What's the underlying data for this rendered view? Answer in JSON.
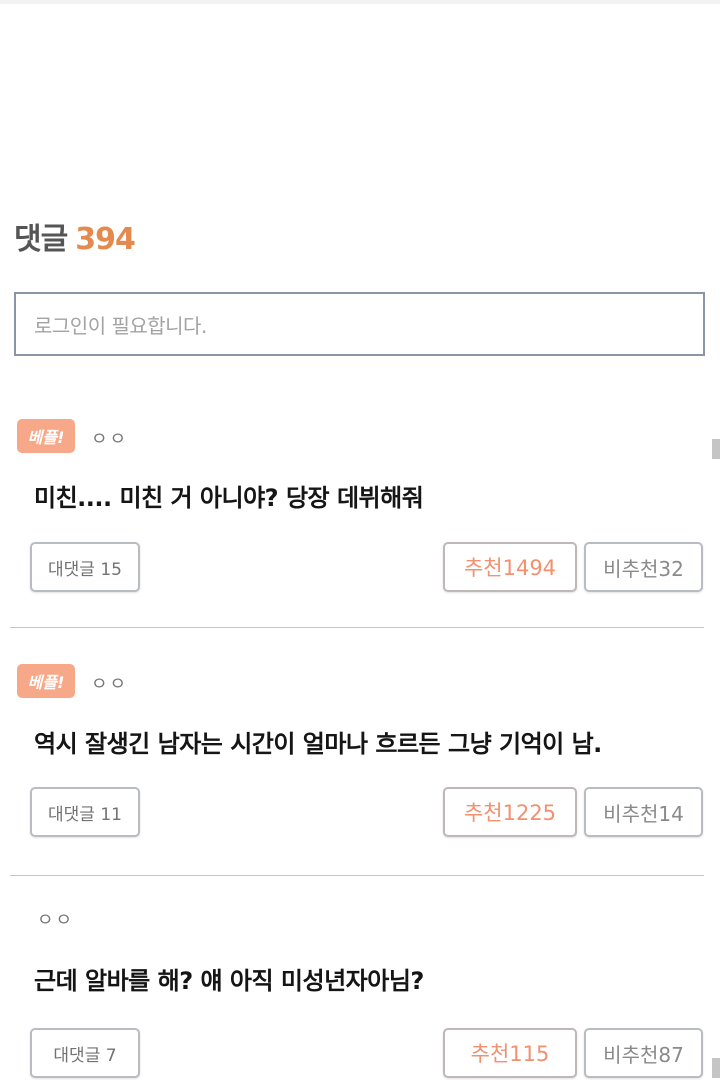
{
  "comments_header": {
    "label": "댓글",
    "count": "394"
  },
  "login_box": {
    "placeholder": "로그인이 필요합니다."
  },
  "comments": [
    {
      "badge": "베플!",
      "author": "ㅇㅇ",
      "text": "미친.... 미친 거 아니야? 당장 데뷔해줘",
      "reply_label": "대댓글 15",
      "like_label": "추천1494",
      "dislike_label": "비추천32"
    },
    {
      "badge": "베플!",
      "author": "ㅇㅇ",
      "text": "역시 잘생긴 남자는 시간이 얼마나 흐르든 그냥 기억이 남.",
      "reply_label": "대댓글 11",
      "like_label": "추천1225",
      "dislike_label": "비추천14"
    },
    {
      "badge": "",
      "author": "ㅇㅇ",
      "text": "근데 알바를 해? 얘 아직 미성년자아님?",
      "reply_label": "대댓글 7",
      "like_label": "추천115",
      "dislike_label": "비추천87"
    }
  ],
  "colors": {
    "accent_count": "#e58a4f",
    "badge_bg": "#f7a888",
    "like_text": "#f29070",
    "border": "#8a96a8"
  }
}
